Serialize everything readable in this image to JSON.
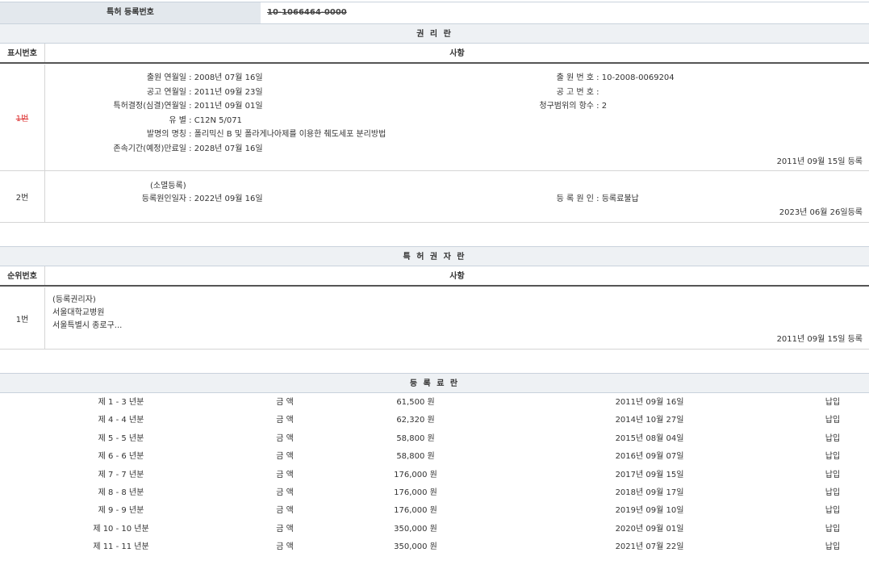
{
  "registration": {
    "label": "특허 등록번호",
    "value": "10-1066464-0000"
  },
  "rights": {
    "title": "권 리 란",
    "col_num": "표시번호",
    "col_content": "사항",
    "entries": [
      {
        "num": "1번",
        "left": [
          {
            "key": "출원 연월일",
            "value": "2008년 07월 16일"
          },
          {
            "key": "공고 연월일",
            "value": "2011년 09월 23일"
          },
          {
            "key": "특허결정(심결)연월일",
            "value": "2011년 09월 01일"
          },
          {
            "key": "유 별",
            "value": "C12N 5/071"
          },
          {
            "key": "발명의 명칭",
            "value": "폴리믹신 B 및 폴라게나아제를 이용한 췌도세포 분리방법"
          },
          {
            "key": "존속기간(예정)만료일",
            "value": "2028년 07월 16일"
          }
        ],
        "right": [
          {
            "key": "출 원 번 호",
            "value": "10-2008-0069204"
          },
          {
            "key": "공 고 번 호",
            "value": ""
          },
          {
            "key": "청구범위의 항수",
            "value": "2"
          }
        ],
        "reg_date": "2011년 09월 15일 등록"
      },
      {
        "num": "2번",
        "heading": "(소멸등록)",
        "left": [
          {
            "key": "등록원인일자",
            "value": "2022년 09월 16일"
          }
        ],
        "right": [
          {
            "key": "등 록 원 인",
            "value": "등록료불납"
          }
        ],
        "reg_date": "2023년 06월 26일등록"
      }
    ]
  },
  "holders": {
    "title": "특 허 권 자 란",
    "col_num": "순위번호",
    "col_content": "사항",
    "entries": [
      {
        "num": "1번",
        "lines": [
          "(등록권리자)",
          "서울대학교병원",
          "서울특별시 종로구..."
        ],
        "reg_date": "2011년 09월 15일 등록"
      }
    ]
  },
  "fees": {
    "title": "등 록 료 란",
    "rows": [
      {
        "period": "제 1 - 3 년분",
        "label": "금 액",
        "amount": "61,500 원",
        "date": "2011년 09월 16일",
        "status": "납입"
      },
      {
        "period": "제 4 - 4 년분",
        "label": "금 액",
        "amount": "62,320 원",
        "date": "2014년 10월 27일",
        "status": "납입"
      },
      {
        "period": "제 5 - 5 년분",
        "label": "금 액",
        "amount": "58,800 원",
        "date": "2015년 08월 04일",
        "status": "납입"
      },
      {
        "period": "제 6 - 6 년분",
        "label": "금 액",
        "amount": "58,800 원",
        "date": "2016년 09월 07일",
        "status": "납입"
      },
      {
        "period": "제 7 - 7 년분",
        "label": "금 액",
        "amount": "176,000 원",
        "date": "2017년 09월 15일",
        "status": "납입"
      },
      {
        "period": "제 8 - 8 년분",
        "label": "금 액",
        "amount": "176,000 원",
        "date": "2018년 09월 17일",
        "status": "납입"
      },
      {
        "period": "제 9 - 9 년분",
        "label": "금 액",
        "amount": "176,000 원",
        "date": "2019년 09월 10일",
        "status": "납입"
      },
      {
        "period": "제 10 - 10 년분",
        "label": "금 액",
        "amount": "350,000 원",
        "date": "2020년 09월 01일",
        "status": "납입"
      },
      {
        "period": "제 11 - 11 년분",
        "label": "금 액",
        "amount": "350,000 원",
        "date": "2021년 07월 22일",
        "status": "납입"
      }
    ]
  }
}
